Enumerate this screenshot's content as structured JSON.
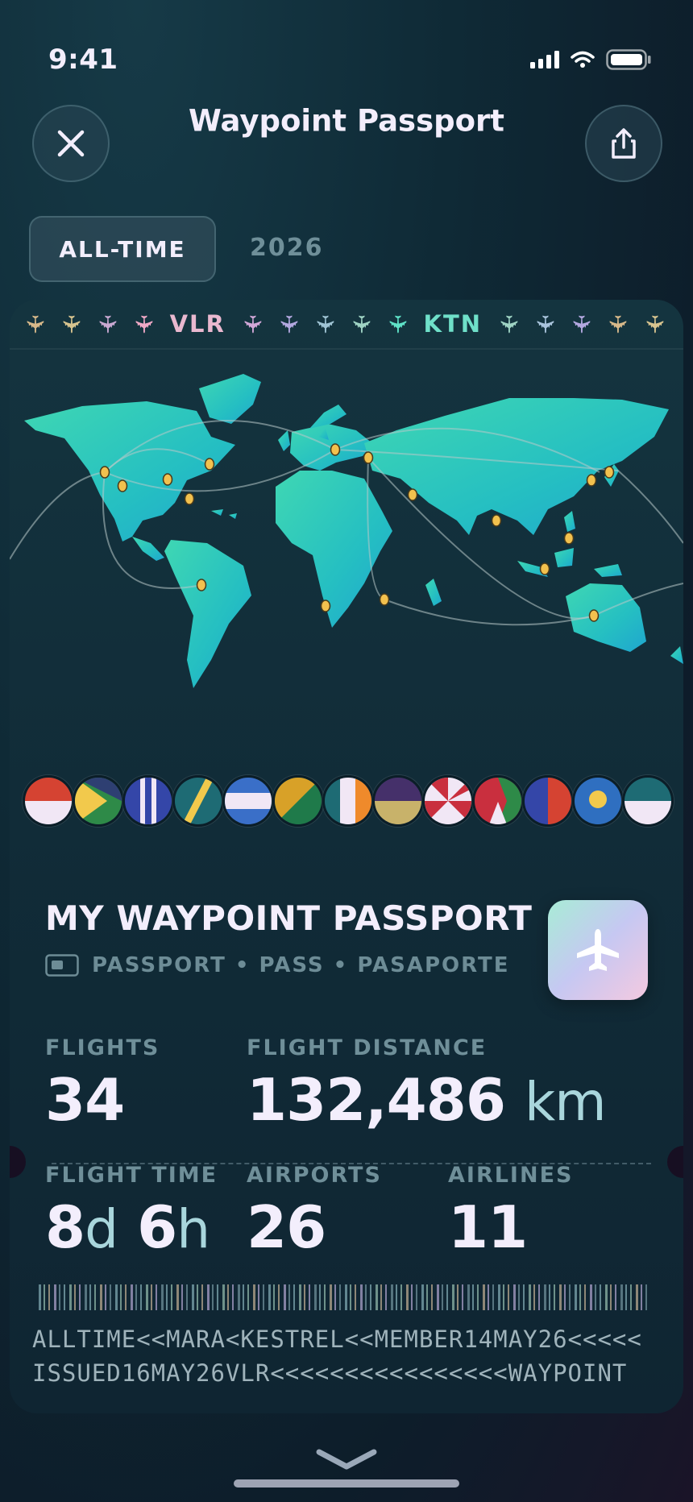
{
  "status_bar": {
    "time": "9:41"
  },
  "header": {
    "title": "Waypoint Passport"
  },
  "segments": [
    {
      "label": "ALL-TIME",
      "active": true
    },
    {
      "label": "2026",
      "active": false
    }
  ],
  "ticker": {
    "codes": [
      "VLR",
      "KTN"
    ]
  },
  "passport": {
    "title": "MY WAYPOINT PASSPORT",
    "subtitle": "PASSPORT • PASS • PASAPORTE"
  },
  "stats": {
    "flights": {
      "label": "FLIGHTS",
      "value": "34"
    },
    "distance": {
      "label": "FLIGHT DISTANCE",
      "value": "132,486",
      "unit": "km"
    },
    "time": {
      "label": "FLIGHT TIME",
      "days": "8",
      "days_unit": "d",
      "hours": "6",
      "hours_unit": "h"
    },
    "airports": {
      "label": "AIRPORTS",
      "value": "26"
    },
    "airlines": {
      "label": "AIRLINES",
      "value": "11"
    }
  },
  "mrz": {
    "line1": "ALLTIME<<MARA<KESTREL<<MEMBER14MAY26<<<<<",
    "line2": "ISSUED16MAY26VLR<<<<<<<<<<<<<<<<WAYPOINT"
  },
  "colors": {
    "background": "#0f2a36",
    "accent_teal": "#2ec4b6",
    "text_primary": "#f3eefc",
    "text_muted": "#6f8f99",
    "pin": "#f2c14e"
  },
  "icons": [
    "close-icon",
    "share-icon",
    "airplane-icon",
    "passport-icon",
    "chevron-down-icon",
    "signal-icon",
    "wifi-icon",
    "battery-icon"
  ]
}
